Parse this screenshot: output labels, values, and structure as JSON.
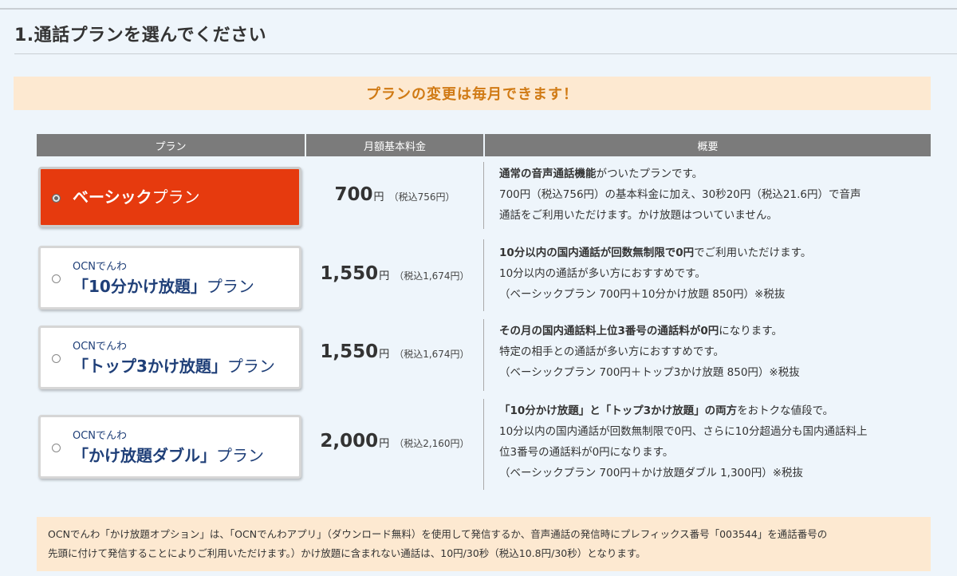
{
  "page": {
    "section_title": "1.通話プランを選んでください",
    "notice": "プランの変更は毎月できます！"
  },
  "table": {
    "headers": [
      "プラン",
      "月額基本料金",
      "概要"
    ]
  },
  "plans": [
    {
      "name_bold": "ベーシック",
      "name_suffix": "プラン",
      "selected": true,
      "price": "700",
      "yen": "円",
      "tax": "（税込756円）",
      "desc": [
        {
          "bold": "通常の音声通話機能",
          "rest": "がついたプランです。"
        },
        {
          "bold": "",
          "rest": "700円（税込756円）の基本料金に加え、30秒20円（税込21.6円）で音声"
        },
        {
          "bold": "",
          "rest": "通話をご利用いただけます。かけ放題はついていません。"
        }
      ]
    },
    {
      "prefix": "OCNでんわ",
      "name_bold": "「10分かけ放題」",
      "name_suffix": "プラン",
      "selected": false,
      "price": "1,550",
      "yen": "円",
      "tax": "（税込1,674円）",
      "desc": [
        {
          "bold": "10分以内の国内通話が回数無制限で0円",
          "rest": "でご利用いただけます。"
        },
        {
          "bold": "",
          "rest": "10分以内の通話が多い方におすすめです。"
        },
        {
          "bold": "",
          "rest": "（ベーシックプラン 700円＋10分かけ放題 850円）※税抜"
        }
      ]
    },
    {
      "prefix": "OCNでんわ",
      "name_bold": "「トップ3かけ放題」",
      "name_suffix": "プラン",
      "selected": false,
      "price": "1,550",
      "yen": "円",
      "tax": "（税込1,674円）",
      "desc": [
        {
          "bold": "その月の国内通話料上位3番号の通話料が0円",
          "rest": "になります。"
        },
        {
          "bold": "",
          "rest": "特定の相手との通話が多い方におすすめです。"
        },
        {
          "bold": "",
          "rest": "（ベーシックプラン 700円＋トップ3かけ放題 850円）※税抜"
        }
      ]
    },
    {
      "prefix": "OCNでんわ",
      "name_bold": "「かけ放題ダブル」",
      "name_suffix": "プラン",
      "selected": false,
      "price": "2,000",
      "yen": "円",
      "tax": "（税込2,160円）",
      "desc": [
        {
          "bold": "「10分かけ放題」と「トップ3かけ放題」の両方",
          "rest": "をおトクな値段で。"
        },
        {
          "bold": "",
          "rest": "10分以内の国内通話が回数無制限で0円、さらに10分超過分も国内通話料上"
        },
        {
          "bold": "",
          "rest": "位3番号の通話料が0円になります。"
        },
        {
          "bold": "",
          "rest": "（ベーシックプラン 700円＋かけ放題ダブル 1,300円）※税抜"
        }
      ]
    }
  ],
  "footer": {
    "line1": "OCNでんわ「かけ放題オプション」は、「OCNでんわアプリ」（ダウンロード無料）を使用して発信するか、音声通話の発信時にプレフィックス番号「003544」を通話番号の",
    "line2": "先頭に付けて発信することによりご利用いただけます。）かけ放題に含まれない通話は、10円/30秒（税込10.8円/30秒）となります。"
  },
  "colors": {
    "selected_plan": "#e63a0e",
    "notice_bg": "#fde9d1",
    "notice_text": "#d07a14",
    "plan_name_text": "#1f3f78",
    "header_bg": "#7b7b7b"
  }
}
